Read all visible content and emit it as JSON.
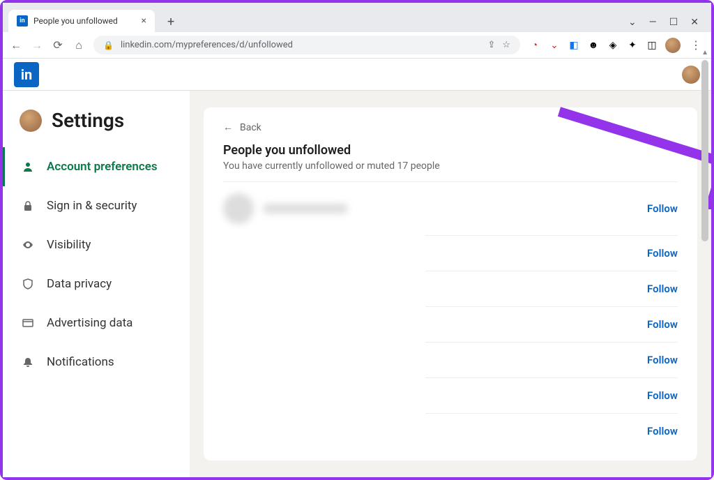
{
  "browser": {
    "tab_title": "People you unfollowed",
    "url": "linkedin.com/mypreferences/d/unfollowed"
  },
  "app": {
    "logo_text": "in"
  },
  "sidebar": {
    "title": "Settings",
    "items": [
      {
        "label": "Account preferences",
        "icon": "person",
        "active": true
      },
      {
        "label": "Sign in & security",
        "icon": "lock",
        "active": false
      },
      {
        "label": "Visibility",
        "icon": "eye",
        "active": false
      },
      {
        "label": "Data privacy",
        "icon": "shield",
        "active": false
      },
      {
        "label": "Advertising data",
        "icon": "browser",
        "active": false
      },
      {
        "label": "Notifications",
        "icon": "bell",
        "active": false
      }
    ]
  },
  "main": {
    "back_label": "Back",
    "heading": "People you unfollowed",
    "subheading": "You have currently unfollowed or muted 17 people",
    "follow_label": "Follow",
    "rows": 7
  },
  "colors": {
    "accent": "#0a66c2",
    "active_nav": "#0b7a4b",
    "annotation": "#9333ea"
  }
}
